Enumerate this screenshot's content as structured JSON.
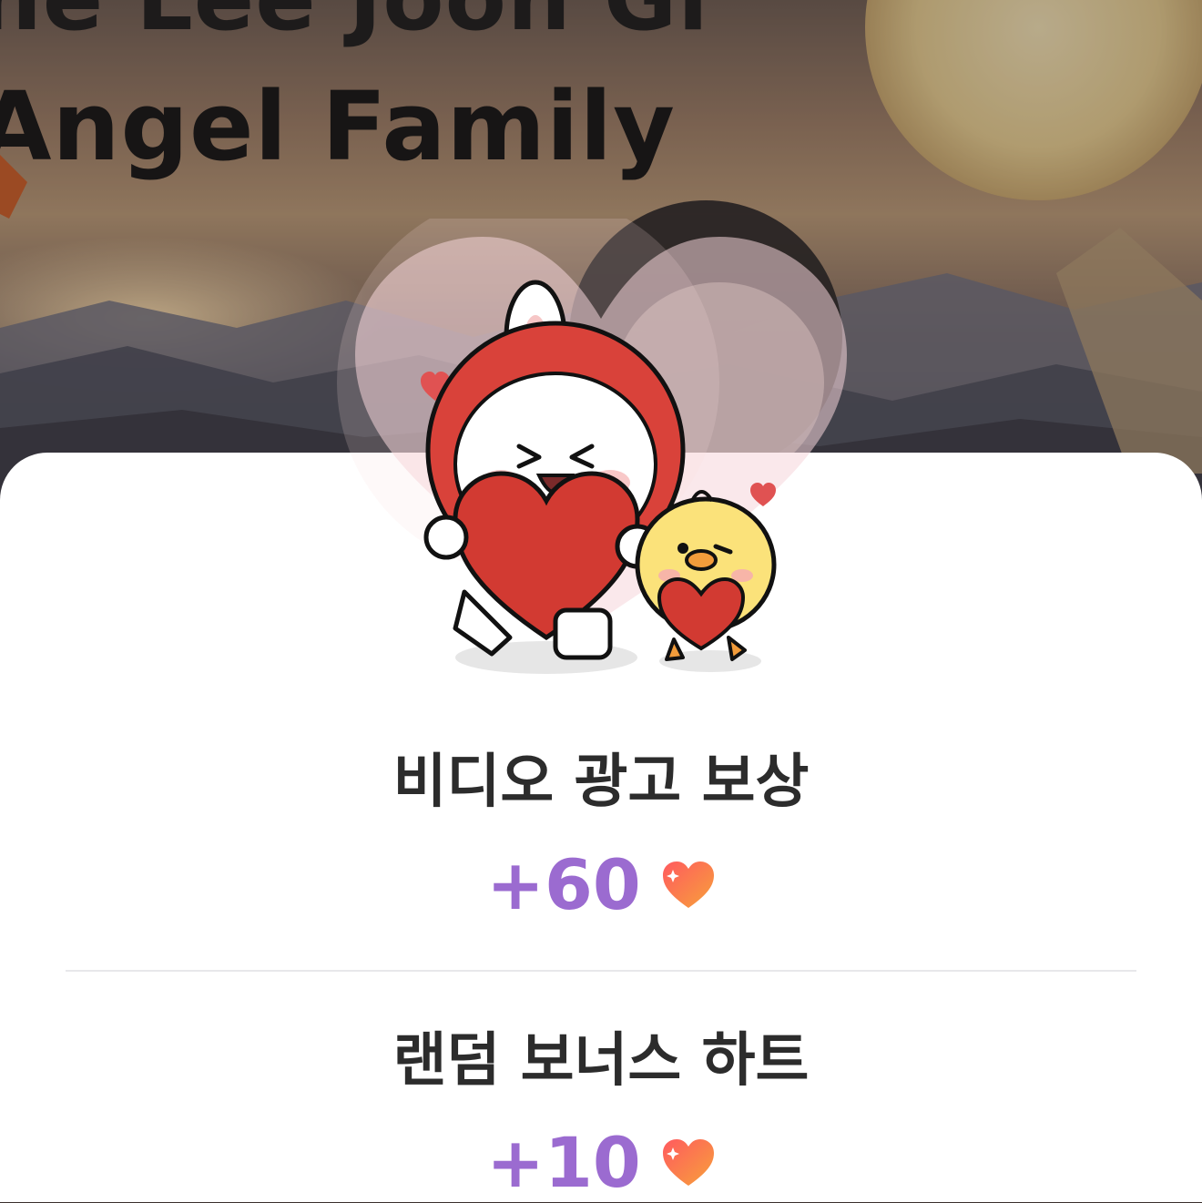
{
  "banner": {
    "line1": "ne Lee Joon Gi",
    "line2": "Angel Family"
  },
  "sections": [
    {
      "title": "비디오 광고 보상",
      "amount": "+60",
      "icon": "heart-icon"
    },
    {
      "title": "랜덤 보너스 하트",
      "amount": "+10",
      "icon": "heart-icon"
    }
  ],
  "colors": {
    "accent": "#9b6bd0",
    "title": "#2c2c2c",
    "heart": "#f2604a"
  }
}
